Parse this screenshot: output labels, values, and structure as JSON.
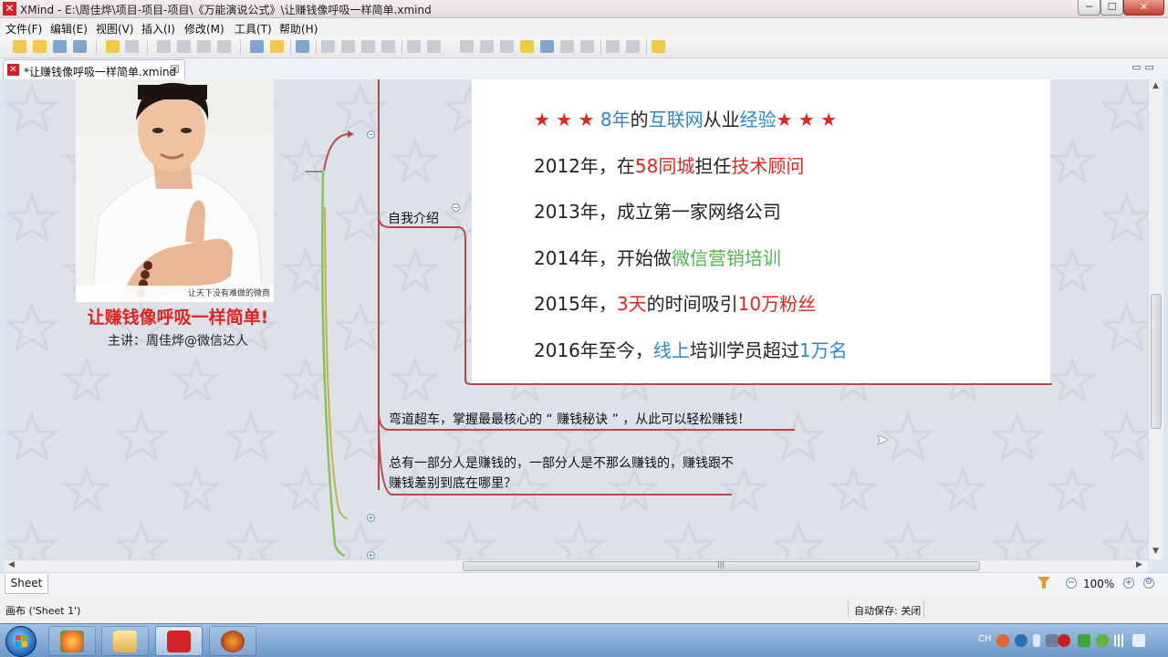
{
  "window": {
    "title": "XMind - E:\\周佳烨\\项目-项目-项目\\《万能演说公式》\\让赚钱像呼吸一样简单.xmind",
    "icon": "xmind-logo-icon",
    "min_label": "─",
    "max_label": "☐",
    "close_label": "✕"
  },
  "menu": [
    {
      "label": "文件(F)"
    },
    {
      "label": "编辑(E)"
    },
    {
      "label": "视图(V)"
    },
    {
      "label": "插入(I)"
    },
    {
      "label": "修改(M)"
    },
    {
      "label": "工具(T)"
    },
    {
      "label": "帮助(H)"
    }
  ],
  "toolbar": {
    "icons": [
      "new-file-icon",
      "open-folder-icon",
      "save-icon",
      "print-icon",
      "undo-icon",
      "redo-icon",
      "cut-icon",
      "copy-icon",
      "paste-icon",
      "delete-icon",
      "comment-icon",
      "idea-bulb-icon",
      "refresh-icon",
      "insert-topic-icon",
      "insert-subtopic-icon",
      "insert-before-icon",
      "insert-parent-icon",
      "relationship-icon",
      "image-icon",
      "boundary-icon",
      "summary-icon",
      "marker-icon",
      "note-icon",
      "hyperlink-icon",
      "attachment-icon",
      "equation-icon",
      "drill-down-icon",
      "drill-up-icon",
      "home-icon"
    ]
  },
  "editor_tab": {
    "label": "*让赚钱像呼吸一样简单.xmind",
    "close": "☒",
    "window_controls": "▭▭"
  },
  "canvas": {
    "photo_caption": "让天下没有难做的微商",
    "main_title": "让赚钱像呼吸一样简单!",
    "speaker": "主讲：周佳烨@微信达人",
    "intro_label": "自我介绍",
    "intro_card": {
      "line1": {
        "stars_left": "★ ★ ★ ",
        "years": "8年",
        "the": "的",
        "internet": "互联网",
        "from": "从业",
        "experience": "经验",
        "stars_right": "★ ★ ★"
      },
      "line2": {
        "prefix": "2012年，在",
        "company": "58同城",
        "mid": "担任",
        "role": "技术顾问"
      },
      "line3": {
        "text": "2013年，成立第一家网络公司"
      },
      "line4": {
        "prefix": "2014年，开始做",
        "highlight": "微信营销培训"
      },
      "line5": {
        "prefix": "2015年，",
        "days": "3天",
        "mid": "的时间吸引",
        "fans": "10万粉丝"
      },
      "line6": {
        "prefix": "2016年至今，",
        "online": "线上",
        "mid": "培训学员超过",
        "count": "1万名"
      }
    },
    "topic_overtake": "弯道超车，掌握最最核心的 “ 赚钱秘诀 ” ，从此可以轻松赚钱！",
    "topic_diff": "总有一部分人是赚钱的，一部分人是不那么赚钱的，赚钱跟不赚钱差别到底在哪里？",
    "collapse_minus": "−",
    "expand_plus": "+",
    "colors": {
      "branch_red": "#b8494a",
      "branch_green": "#84c45a",
      "branch_olive": "#c9b04b",
      "title_red": "#e0241e",
      "highlight_blue": "#2e87c5",
      "highlight_green": "#4cb748"
    }
  },
  "scrollbars": {
    "grip": "|||",
    "up": "▲",
    "down": "▼",
    "left": "◀",
    "right": "▶"
  },
  "sheet_bar": {
    "sheet_tab": "Sheet 1",
    "zoom_level": "100%",
    "zoom_out": "−",
    "zoom_in": "+",
    "zoom_fit": "⊖"
  },
  "status_bar": {
    "left": "画布 ('Sheet 1')",
    "autosave": "自动保存: 关闭"
  },
  "taskbar": {
    "apps": [
      "windows-start-icon",
      "media-center-icon",
      "file-explorer-icon",
      "xmind-taskbar-icon",
      "ninja-app-icon"
    ],
    "tray_lang": "CH",
    "tray_icons": [
      "sogou-input-icon",
      "help-icon",
      "pin-icon",
      "keyboard-icon",
      "antivirus-red-icon",
      "shield-green-icon",
      "plus-green-icon",
      "signal-bars-icon",
      "volume-icon"
    ]
  }
}
